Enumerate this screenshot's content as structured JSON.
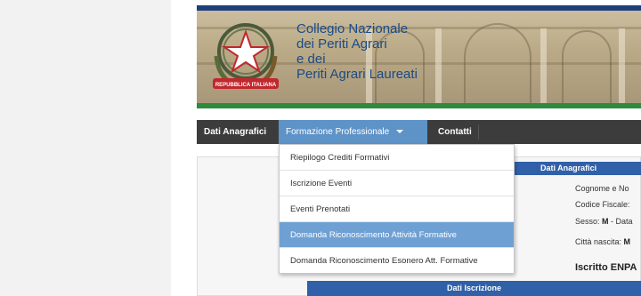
{
  "header": {
    "title_lines": [
      "Collegio Nazionale",
      "dei Periti Agrari",
      "e dei",
      "Periti Agrari Laureati"
    ],
    "emblem_text": "REPUBBLICA ITALIANA",
    "colors": {
      "title": "#1a4a86",
      "top_bar": "#1f3f7a",
      "bottom_bar": "#2e8b3e"
    }
  },
  "nav": {
    "items": [
      {
        "label": "Dati Anagrafici"
      },
      {
        "label": "Formazione Professionale",
        "active": true
      },
      {
        "label": "Contatti"
      }
    ],
    "colors": {
      "bar": "#3c3c3c",
      "active": "#5e93c8"
    }
  },
  "dropdown": {
    "items": [
      {
        "label": "Riepilogo Crediti Formativi"
      },
      {
        "label": "Iscrizione Eventi"
      },
      {
        "label": "Eventi Prenotati"
      },
      {
        "label": "Domanda Riconoscimento Attività Formative",
        "highlighted": true
      },
      {
        "label": "Domanda Riconoscimento Esonero Att. Formative"
      }
    ],
    "highlight_color": "#6fa0d4"
  },
  "info_panel": {
    "title": "Dati Anagrafici",
    "rows": {
      "cognome": "Cognome e No",
      "codice": "Codice Fiscale:",
      "sesso_label": "Sesso: ",
      "sesso_value": "M",
      "data": " - Data",
      "citta_label": "Città nascita: ",
      "citta_value": "M"
    },
    "enpa": "Iscritto ENPA",
    "section2_title": "Dati Iscrizione",
    "colors": {
      "header": "#3060a8"
    }
  }
}
